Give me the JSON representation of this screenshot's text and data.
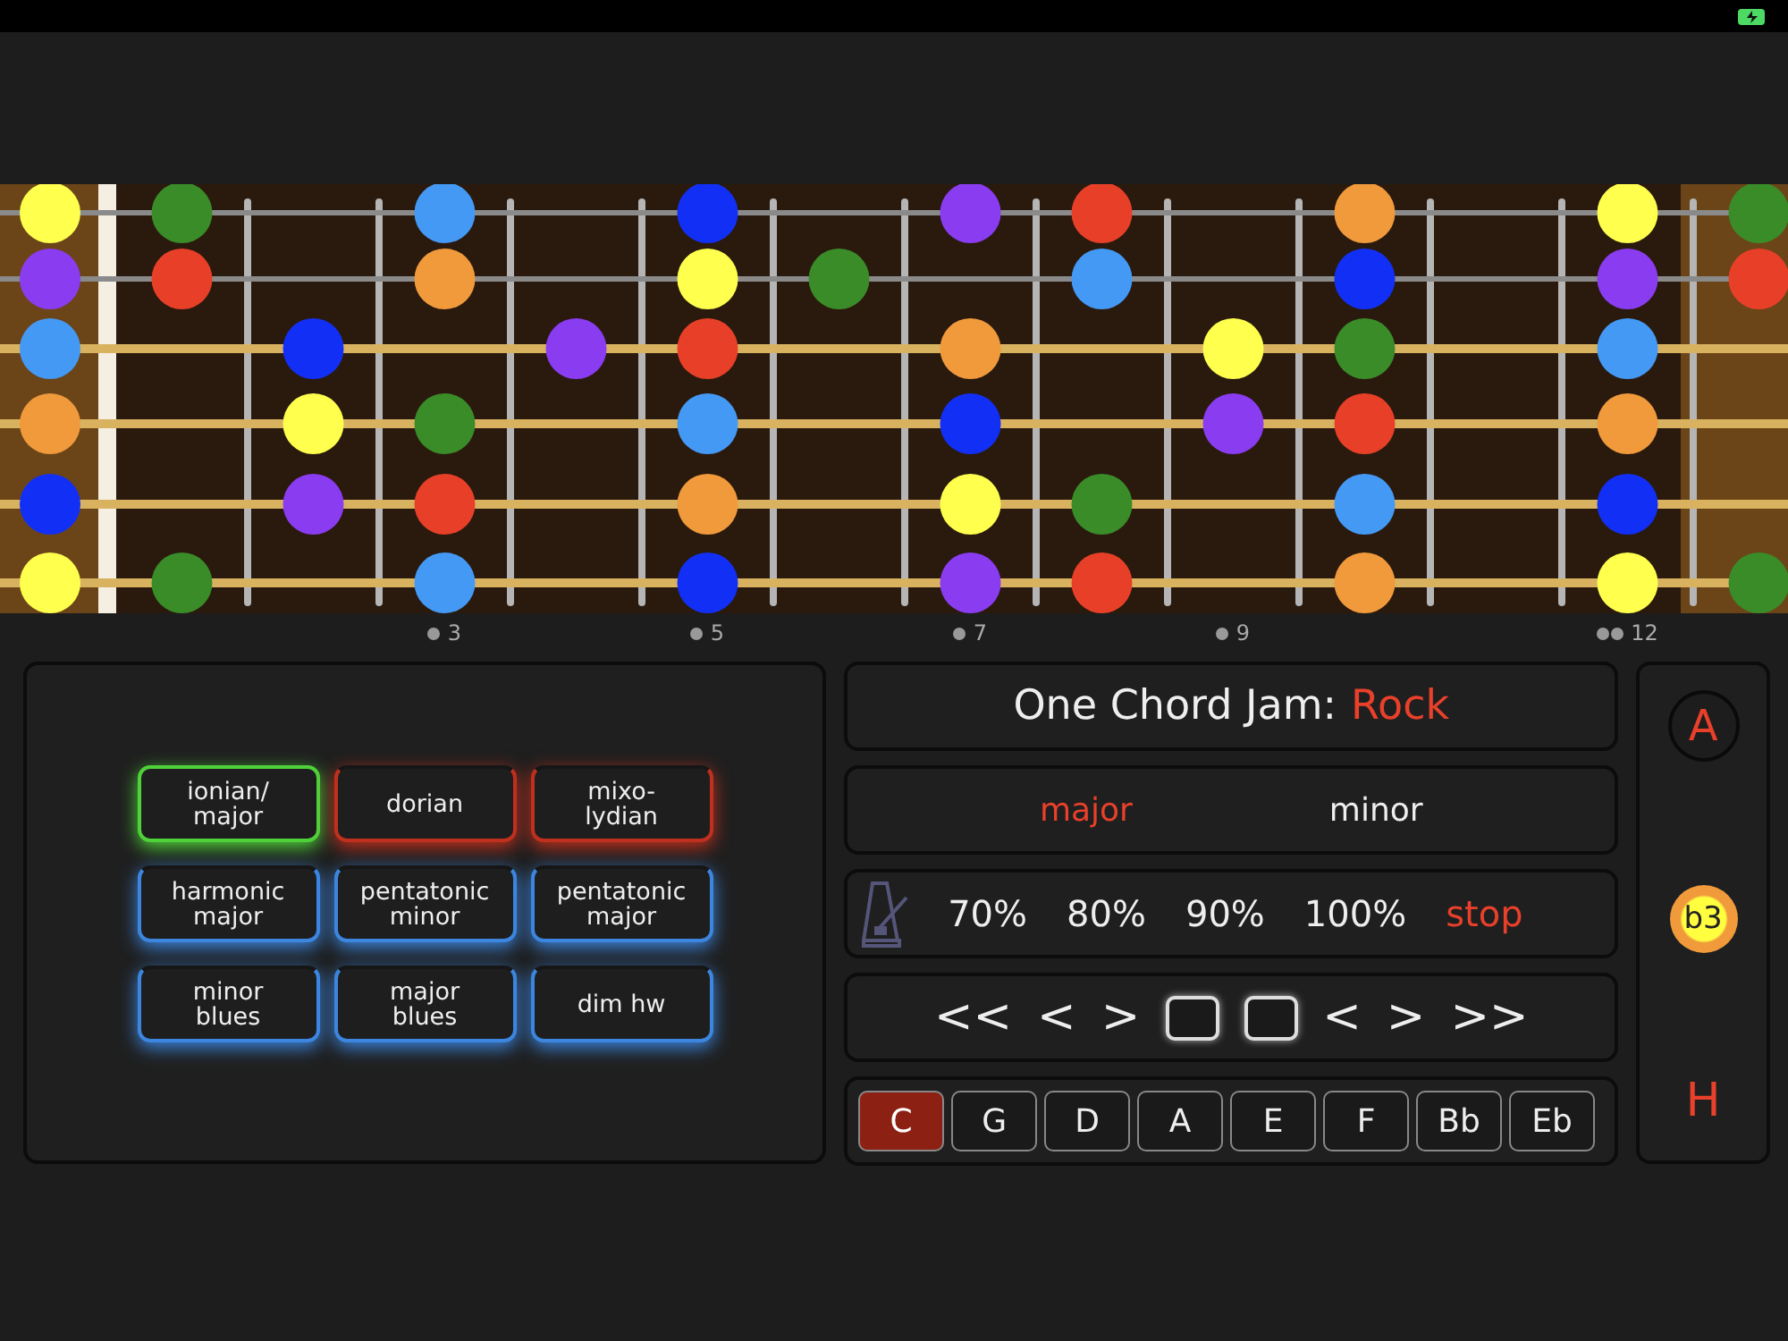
{
  "fretboard": {
    "strings": [
      {
        "kind": "plain",
        "slots": [
          {
            "kind": "dot",
            "color": "#ffff4d"
          },
          {
            "kind": "dot",
            "color": "#3a8c28"
          },
          {
            "kind": "blank"
          },
          {
            "kind": "dot",
            "color": "#4499f5"
          },
          {
            "kind": "blank"
          },
          {
            "kind": "dot",
            "color": "#1230f5"
          },
          {
            "kind": "blank"
          },
          {
            "kind": "dot",
            "color": "#8a3cf0"
          },
          {
            "kind": "dot",
            "color": "#e84028"
          },
          {
            "kind": "blank"
          },
          {
            "kind": "dot",
            "color": "#f09a3c"
          },
          {
            "kind": "blank"
          },
          {
            "kind": "dot",
            "color": "#ffff4d"
          },
          {
            "kind": "dot",
            "color": "#3a8c28"
          }
        ]
      },
      {
        "kind": "plain",
        "slots": [
          {
            "kind": "dot",
            "color": "#8a3cf0"
          },
          {
            "kind": "dot",
            "color": "#e84028"
          },
          {
            "kind": "blank"
          },
          {
            "kind": "dot",
            "color": "#f09a3c"
          },
          {
            "kind": "blank"
          },
          {
            "kind": "dot",
            "color": "#ffff4d"
          },
          {
            "kind": "dot",
            "color": "#3a8c28"
          },
          {
            "kind": "blank"
          },
          {
            "kind": "dot",
            "color": "#4499f5"
          },
          {
            "kind": "blank"
          },
          {
            "kind": "dot",
            "color": "#1230f5"
          },
          {
            "kind": "blank"
          },
          {
            "kind": "dot",
            "color": "#8a3cf0"
          },
          {
            "kind": "dot",
            "color": "#e84028"
          }
        ]
      },
      {
        "kind": "wound",
        "slots": [
          {
            "kind": "dot",
            "color": "#4499f5"
          },
          {
            "kind": "blank"
          },
          {
            "kind": "dot",
            "color": "#1230f5"
          },
          {
            "kind": "blank"
          },
          {
            "kind": "dot",
            "color": "#8a3cf0"
          },
          {
            "kind": "dot",
            "color": "#e84028"
          },
          {
            "kind": "blank"
          },
          {
            "kind": "dot",
            "color": "#f09a3c"
          },
          {
            "kind": "blank"
          },
          {
            "kind": "dot",
            "color": "#ffff4d"
          },
          {
            "kind": "dot",
            "color": "#3a8c28"
          },
          {
            "kind": "blank"
          },
          {
            "kind": "dot",
            "color": "#4499f5"
          }
        ]
      },
      {
        "kind": "wound",
        "slots": [
          {
            "kind": "dot",
            "color": "#f09a3c"
          },
          {
            "kind": "blank"
          },
          {
            "kind": "dot",
            "color": "#ffff4d"
          },
          {
            "kind": "dot",
            "color": "#3a8c28"
          },
          {
            "kind": "blank"
          },
          {
            "kind": "dot",
            "color": "#4499f5"
          },
          {
            "kind": "blank"
          },
          {
            "kind": "dot",
            "color": "#1230f5"
          },
          {
            "kind": "blank"
          },
          {
            "kind": "dot",
            "color": "#8a3cf0"
          },
          {
            "kind": "dot",
            "color": "#e84028"
          },
          {
            "kind": "blank"
          },
          {
            "kind": "dot",
            "color": "#f09a3c"
          }
        ]
      },
      {
        "kind": "wound",
        "slots": [
          {
            "kind": "dot",
            "color": "#1230f5"
          },
          {
            "kind": "blank"
          },
          {
            "kind": "dot",
            "color": "#8a3cf0"
          },
          {
            "kind": "dot",
            "color": "#e84028"
          },
          {
            "kind": "blank"
          },
          {
            "kind": "dot",
            "color": "#f09a3c"
          },
          {
            "kind": "blank"
          },
          {
            "kind": "dot",
            "color": "#ffff4d"
          },
          {
            "kind": "dot",
            "color": "#3a8c28"
          },
          {
            "kind": "blank"
          },
          {
            "kind": "dot",
            "color": "#4499f5"
          },
          {
            "kind": "blank"
          },
          {
            "kind": "dot",
            "color": "#1230f5"
          }
        ]
      },
      {
        "kind": "wound",
        "slots": [
          {
            "kind": "dot",
            "color": "#ffff4d"
          },
          {
            "kind": "dot",
            "color": "#3a8c28"
          },
          {
            "kind": "blank"
          },
          {
            "kind": "dot",
            "color": "#4499f5"
          },
          {
            "kind": "blank"
          },
          {
            "kind": "dot",
            "color": "#1230f5"
          },
          {
            "kind": "blank"
          },
          {
            "kind": "dot",
            "color": "#8a3cf0"
          },
          {
            "kind": "dot",
            "color": "#e84028"
          },
          {
            "kind": "blank"
          },
          {
            "kind": "dot",
            "color": "#f09a3c"
          },
          {
            "kind": "blank"
          },
          {
            "kind": "dot",
            "color": "#ffff4d"
          },
          {
            "kind": "dot",
            "color": "#3a8c28"
          }
        ]
      }
    ],
    "fret_marks": [
      {
        "kind": "blank"
      },
      {
        "kind": "blank"
      },
      {
        "kind": "blank"
      },
      {
        "kind": "mark",
        "label": "3",
        "double": false
      },
      {
        "kind": "blank"
      },
      {
        "kind": "mark",
        "label": "5",
        "double": false
      },
      {
        "kind": "blank"
      },
      {
        "kind": "mark",
        "label": "7",
        "double": false
      },
      {
        "kind": "blank"
      },
      {
        "kind": "mark",
        "label": "9",
        "double": false
      },
      {
        "kind": "blank"
      },
      {
        "kind": "blank"
      },
      {
        "kind": "mark",
        "label": "12",
        "double": true
      }
    ]
  },
  "scales": [
    {
      "label": "ionian/ major",
      "color": "#4fd13a",
      "selected": true
    },
    {
      "label": "dorian",
      "color": "#c0301e",
      "selected": false
    },
    {
      "label": "mixo-lydian",
      "color": "#c0301e",
      "selected": false
    },
    {
      "label": "harmonic major",
      "color": "#3c86e0",
      "selected": false
    },
    {
      "label": "pentatonic minor",
      "color": "#3c86e0",
      "selected": false
    },
    {
      "label": "pentatonic major",
      "color": "#3c86e0",
      "selected": false
    },
    {
      "label": "minor blues",
      "color": "#3c86e0",
      "selected": false
    },
    {
      "label": "major blues",
      "color": "#3c86e0",
      "selected": false
    },
    {
      "label": "dim hw",
      "color": "#3c86e0",
      "selected": false
    }
  ],
  "jam": {
    "title": "One Chord Jam:",
    "style": "Rock"
  },
  "modes": [
    {
      "label": "major",
      "selected": true
    },
    {
      "label": "minor",
      "selected": false
    }
  ],
  "tempos": [
    {
      "label": "70%",
      "selected": false
    },
    {
      "label": "80%",
      "selected": false
    },
    {
      "label": "90%",
      "selected": false
    },
    {
      "label": "100%",
      "selected": false
    },
    {
      "label": "stop",
      "selected": true
    }
  ],
  "transport": [
    {
      "kind": "text",
      "label": "<<"
    },
    {
      "kind": "text",
      "label": "<"
    },
    {
      "kind": "text",
      "label": ">"
    },
    {
      "kind": "square"
    },
    {
      "kind": "square"
    },
    {
      "kind": "text",
      "label": "<"
    },
    {
      "kind": "text",
      "label": ">"
    },
    {
      "kind": "text",
      "label": ">>"
    }
  ],
  "keys": [
    {
      "label": "C",
      "selected": true
    },
    {
      "label": "G",
      "selected": false
    },
    {
      "label": "D",
      "selected": false
    },
    {
      "label": "A",
      "selected": false
    },
    {
      "label": "E",
      "selected": false
    },
    {
      "label": "F",
      "selected": false
    },
    {
      "label": "Bb",
      "selected": false
    },
    {
      "label": "Eb",
      "selected": false
    }
  ],
  "side": [
    {
      "kind": "ring",
      "label": "A"
    },
    {
      "kind": "disc",
      "label": "b3"
    },
    {
      "kind": "plain",
      "label": "H"
    }
  ]
}
